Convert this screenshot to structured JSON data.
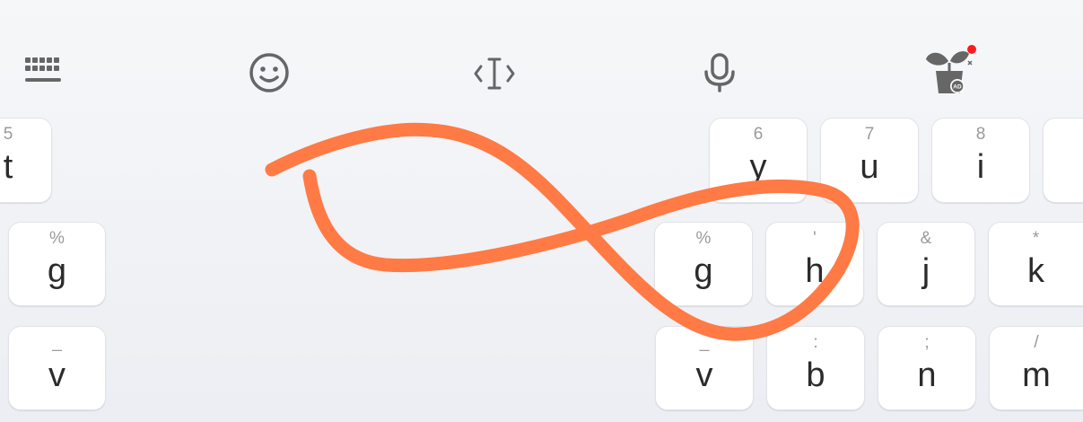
{
  "toolbar": {
    "items": [
      {
        "icon": "keyboard-grid-icon"
      },
      {
        "icon": "emoji-icon"
      },
      {
        "icon": "cursor-control-icon"
      },
      {
        "icon": "microphone-icon"
      },
      {
        "icon": "plant-pot-ad-icon",
        "badge_text": "AD",
        "notification_color": "#ff1a1a"
      }
    ]
  },
  "keys": {
    "t": {
      "sym": "5",
      "label": "t"
    },
    "g_left": {
      "sym": "%",
      "label": "g"
    },
    "v_left": {
      "sym": "_",
      "label": "v"
    },
    "y": {
      "sym": "6",
      "label": "y"
    },
    "u": {
      "sym": "7",
      "label": "u"
    },
    "i": {
      "sym": "8",
      "label": "i"
    },
    "g": {
      "sym": "%",
      "label": "g"
    },
    "h": {
      "sym": "'",
      "label": "h"
    },
    "j": {
      "sym": "&",
      "label": "j"
    },
    "k": {
      "sym": "*",
      "label": "k"
    },
    "v": {
      "sym": "_",
      "label": "v"
    },
    "b": {
      "sym": ":",
      "label": "b"
    },
    "n": {
      "sym": ";",
      "label": "n"
    },
    "m": {
      "sym": "/",
      "label": "m"
    }
  },
  "colors": {
    "icon": "#666666",
    "swipe_trace": "#ff7a45"
  }
}
